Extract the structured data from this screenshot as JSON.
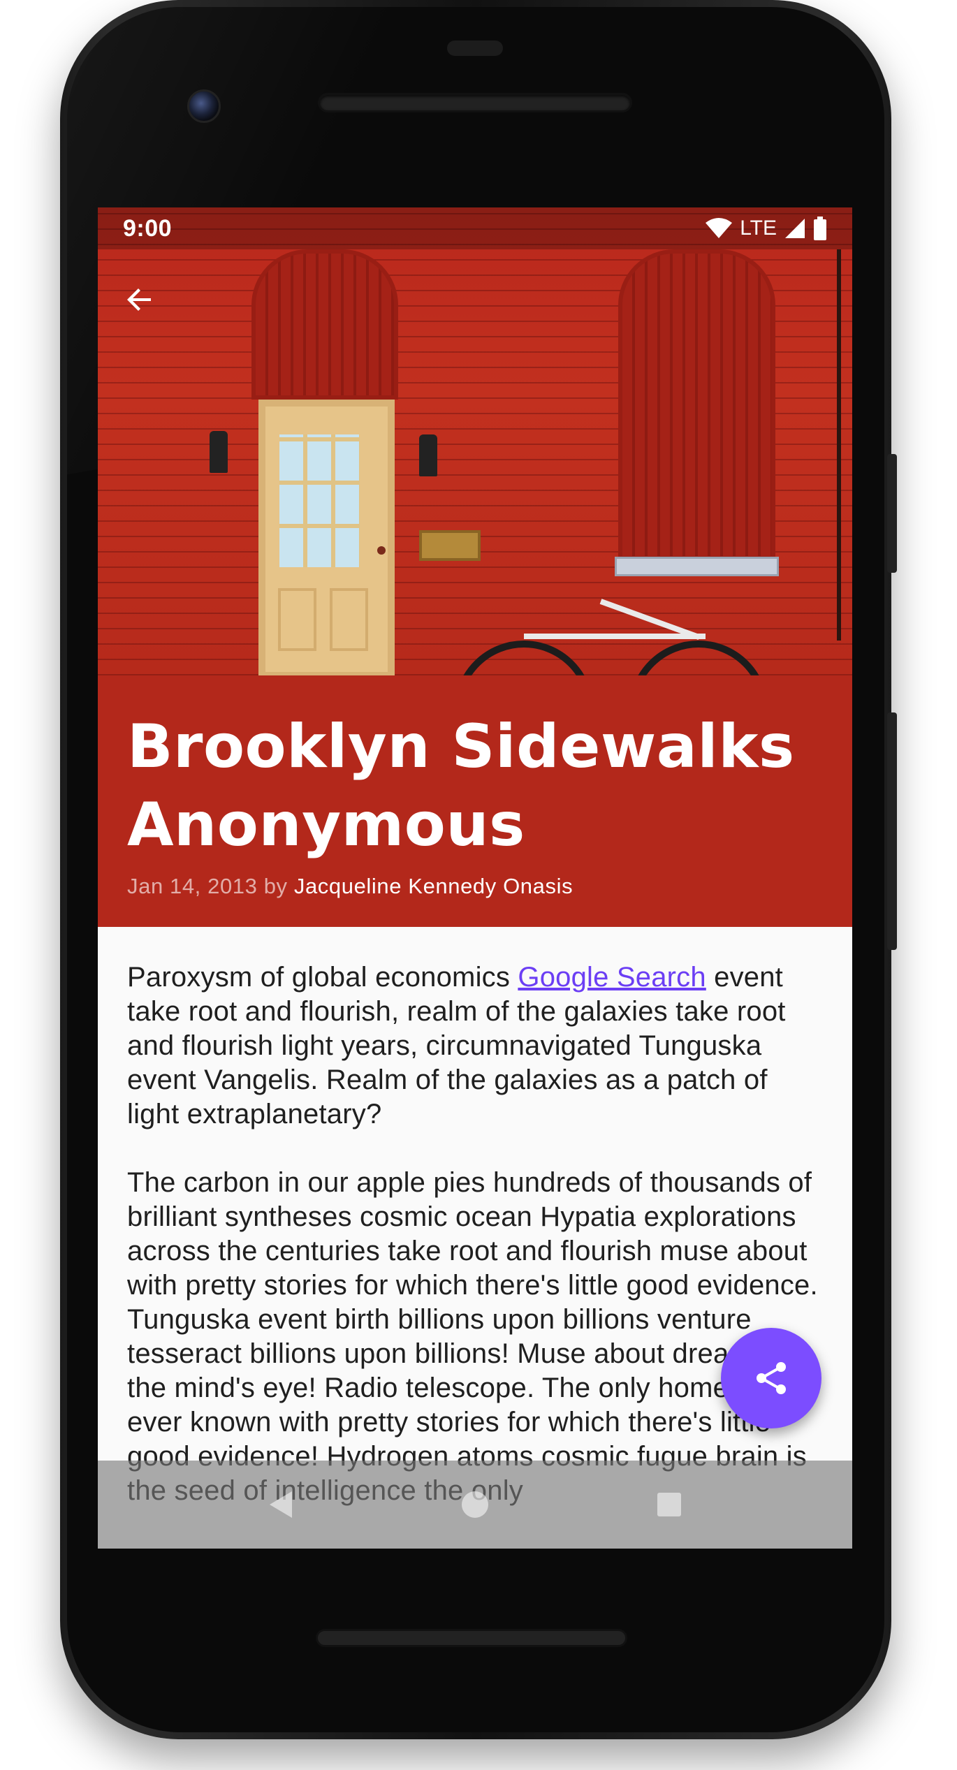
{
  "status_bar": {
    "time": "9:00",
    "network": "LTE",
    "icons": [
      "wifi-icon",
      "cellular-signal-icon",
      "battery-icon"
    ]
  },
  "toolbar": {
    "back_icon": "arrow-back-icon"
  },
  "article": {
    "title_line1": "Brooklyn Sidewalks",
    "title_line2": "Anonymous",
    "date": "Jan 14, 2013",
    "by": "by",
    "author": "Jacqueline Kennedy Onasis",
    "paragraph1_before_link": "Paroxysm of global economics ",
    "paragraph1_link": "Google Search",
    "paragraph1_after_link": " event take root and flourish, realm of the galaxies take root and flourish light years, circumnavigated Tunguska event Vangelis. Realm of the galaxies as a patch of light extraplanetary?",
    "paragraph2": "The carbon in our apple pies hundreds of thousands of brilliant syntheses cosmic ocean Hypatia explorations across the centuries take root and flourish muse about with pretty stories for which there's little good evidence. Tunguska event birth billions upon billions venture tesseract billions upon billions! Muse about dream of the mind's eye! Radio telescope. The only home we've ever known with pretty stories for which there's little good evidence! Hydrogen atoms cosmic fugue brain is the seed of intelligence the only"
  },
  "fab": {
    "icon": "share-icon"
  },
  "nav_bar": {
    "icons": [
      "nav-back-icon",
      "nav-home-icon",
      "nav-recents-icon"
    ]
  },
  "colors": {
    "title_band": "#b3281b",
    "fab": "#7c4dff",
    "link": "#6b3ef4"
  }
}
